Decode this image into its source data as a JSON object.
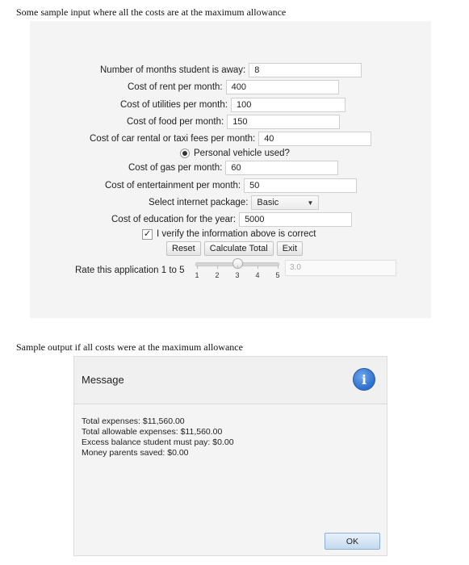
{
  "captions": {
    "input": "Some sample input where all the costs are at the maximum allowance",
    "output": "Sample output if all costs were at the maximum allowance"
  },
  "form": {
    "months": {
      "label": "Number of months student is away:",
      "value": "8"
    },
    "rent": {
      "label": "Cost of rent per month:",
      "value": "400"
    },
    "utilities": {
      "label": "Cost of utilities per month:",
      "value": "100"
    },
    "food": {
      "label": "Cost of food per month:",
      "value": "150"
    },
    "car_rental": {
      "label": "Cost of car rental or taxi fees per month:",
      "value": "40"
    },
    "personal_vehicle": {
      "label": "Personal vehicle used?",
      "selected": true
    },
    "gas": {
      "label": "Cost of gas per month:",
      "value": "60"
    },
    "entertainment": {
      "label": "Cost of entertainment per month:",
      "value": "50"
    },
    "internet": {
      "label": "Select internet package:",
      "selected": "Basic"
    },
    "education": {
      "label": "Cost of education for the year:",
      "value": "5000"
    },
    "verify": {
      "label": "I verify the information above is correct",
      "checked": true,
      "check_glyph": "✓"
    },
    "buttons": {
      "reset": "Reset",
      "calculate": "Calculate Total",
      "exit": "Exit"
    },
    "rating": {
      "label": "Rate this application 1 to 5",
      "ticks": [
        "1",
        "2",
        "3",
        "4",
        "5"
      ],
      "value": 3.0,
      "display": "3.0"
    }
  },
  "dialog": {
    "title": "Message",
    "icon": "info-icon",
    "icon_glyph": "i",
    "lines": [
      "Total expenses: $11,560.00",
      "Total allowable expenses: $11,560.00",
      "Excess balance student must pay: $0.00",
      "Money parents saved: $0.00"
    ],
    "ok_label": "OK"
  },
  "colors": {
    "info_icon": "#2e6fcf",
    "ok_button": "#c4d9ef",
    "panel": "#f4f4f4"
  }
}
